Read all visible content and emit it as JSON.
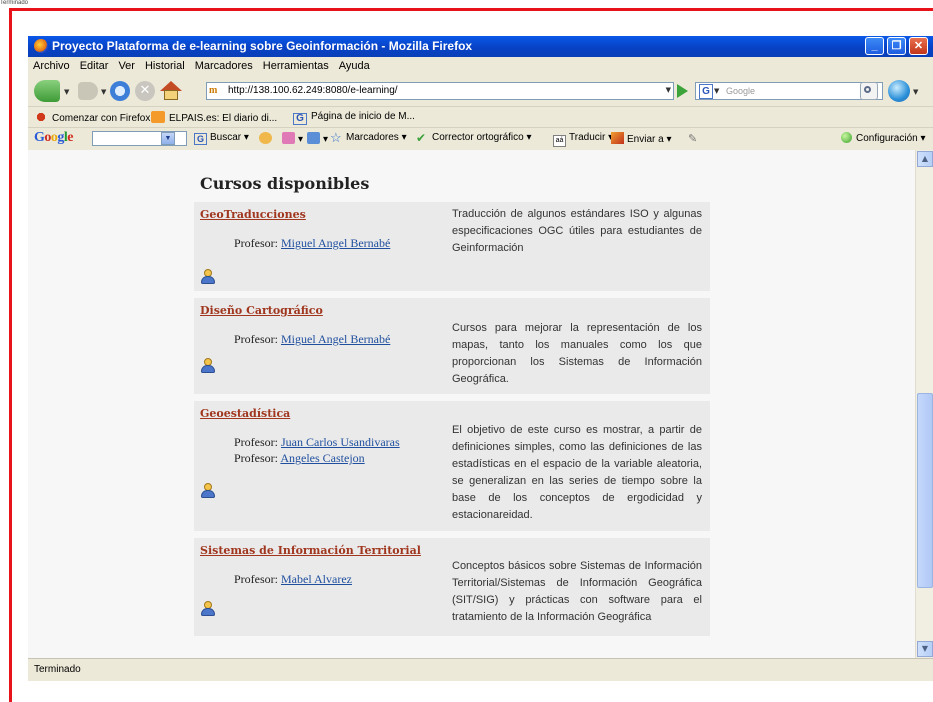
{
  "outer_status": "Terminado",
  "window": {
    "title": "Proyecto Plataforma de e-learning sobre Geoinformación - Mozilla Firefox",
    "controls": {
      "minimize": "_",
      "maximize": "❐",
      "close": "✕"
    }
  },
  "menu": [
    "Archivo",
    "Editar",
    "Ver",
    "Historial",
    "Marcadores",
    "Herramientas",
    "Ayuda"
  ],
  "nav": {
    "url": "http://138.100.62.249:8080/e-learning/",
    "favicon_text": "m",
    "search_placeholder": "Google",
    "search_engine_letter": "G"
  },
  "bookmarks": [
    {
      "label": "Comenzar con Firefox",
      "icon": "firefox-icon"
    },
    {
      "label": "ELPAIS.es: El diario di...",
      "icon": "rss-icon"
    },
    {
      "label": "Página de inicio de M...",
      "icon": "google-icon"
    }
  ],
  "google_toolbar": {
    "logo": {
      "G": "G",
      "o1": "o",
      "o2": "o",
      "g": "g",
      "l": "l",
      "e": "e"
    },
    "search_label": "Buscar",
    "bookmarks_label": "Marcadores",
    "spell_label": "Corrector ortográfico",
    "translate_label": "Traducir",
    "send_label": "Enviar a",
    "settings_label": "Configuración"
  },
  "page": {
    "heading": "Cursos disponibles",
    "professor_label": "Profesor:",
    "courses": [
      {
        "title": "GeoTraducciones",
        "professors": [
          "Miguel Angel Bernabé"
        ],
        "description": "Traducción de algunos estándares ISO y algunas especificaciones OGC útiles para estudiantes de Geinformación"
      },
      {
        "title": "Diseño Cartográfico",
        "professors": [
          "Miguel Angel Bernabé"
        ],
        "description": "Cursos para mejorar la representación de los mapas, tanto los manuales como los que proporcionan los Sistemas de Información Geográfica."
      },
      {
        "title": "Geoestadística",
        "professors": [
          "Juan Carlos Usandivaras",
          "Angeles Castejon"
        ],
        "description": "El objetivo de este curso es mostrar, a partir de definiciones simples, como las definiciones de las estadísticas en el espacio de la variable aleatoria, se generalizan en las series de tiempo sobre la base de los conceptos de ergodicidad y estacionareidad."
      },
      {
        "title": "Sistemas de Información Territorial",
        "professors": [
          "Mabel Alvarez"
        ],
        "description": "Conceptos básicos sobre Sistemas de Información Territorial/Sistemas de Información Geográfica (SIT/SIG) y prácticas con software para el tratamiento de la Información Geográfica"
      }
    ]
  },
  "status": "Terminado",
  "colors": {
    "frame_red": "#e8121a",
    "titlebar_blue": "#0842c5",
    "course_title": "#a0361e",
    "link": "#1f4f9e"
  }
}
